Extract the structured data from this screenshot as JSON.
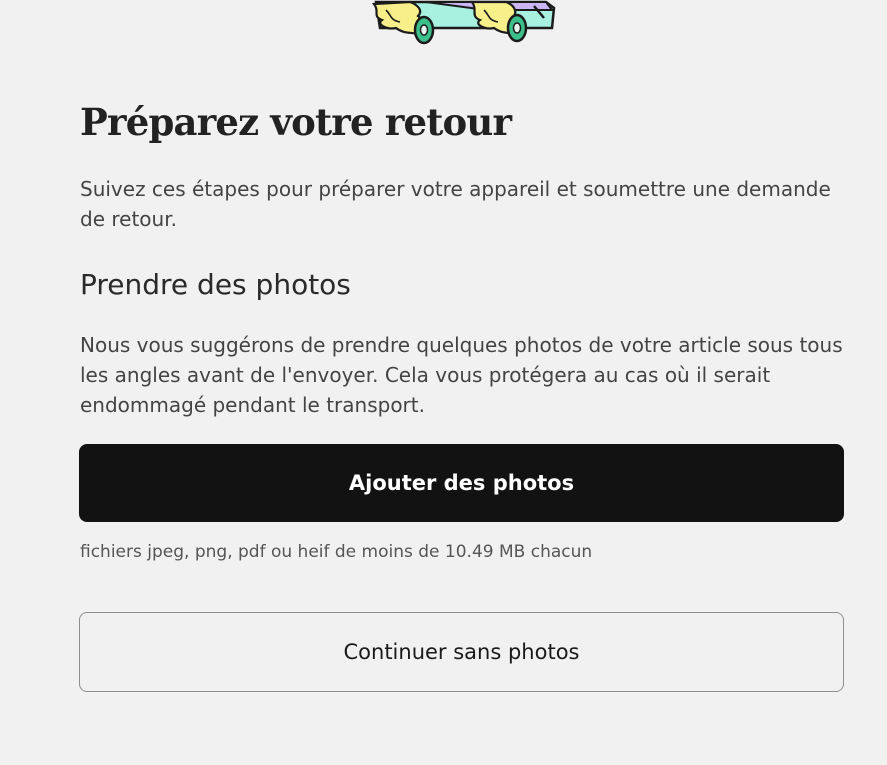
{
  "page": {
    "title": "Préparez votre retour",
    "intro": "Suivez ces étapes pour préparer votre appareil et soumettre une demande de retour."
  },
  "photos_section": {
    "title": "Prendre des photos",
    "description": "Nous vous suggérons de prendre quelques photos de votre article sous tous les angles avant de l'envoyer. Cela vous protégera au cas où il serait endommagé pendant le transport.",
    "add_button_label": "Ajouter des photos",
    "file_hint": "fichiers jpeg, png, pdf ou heif de moins de 10.49 MB chacun",
    "continue_button_label": "Continuer sans photos"
  },
  "illustration": {
    "icon": "flaming-skateboard-illustration",
    "colors": {
      "deck_mint": "#a8f0e0",
      "deck_lavender": "#c9b6f2",
      "flame_yellow": "#f7ef8a",
      "wheel_green": "#3dbf8c",
      "outline": "#1b1b1b"
    }
  }
}
